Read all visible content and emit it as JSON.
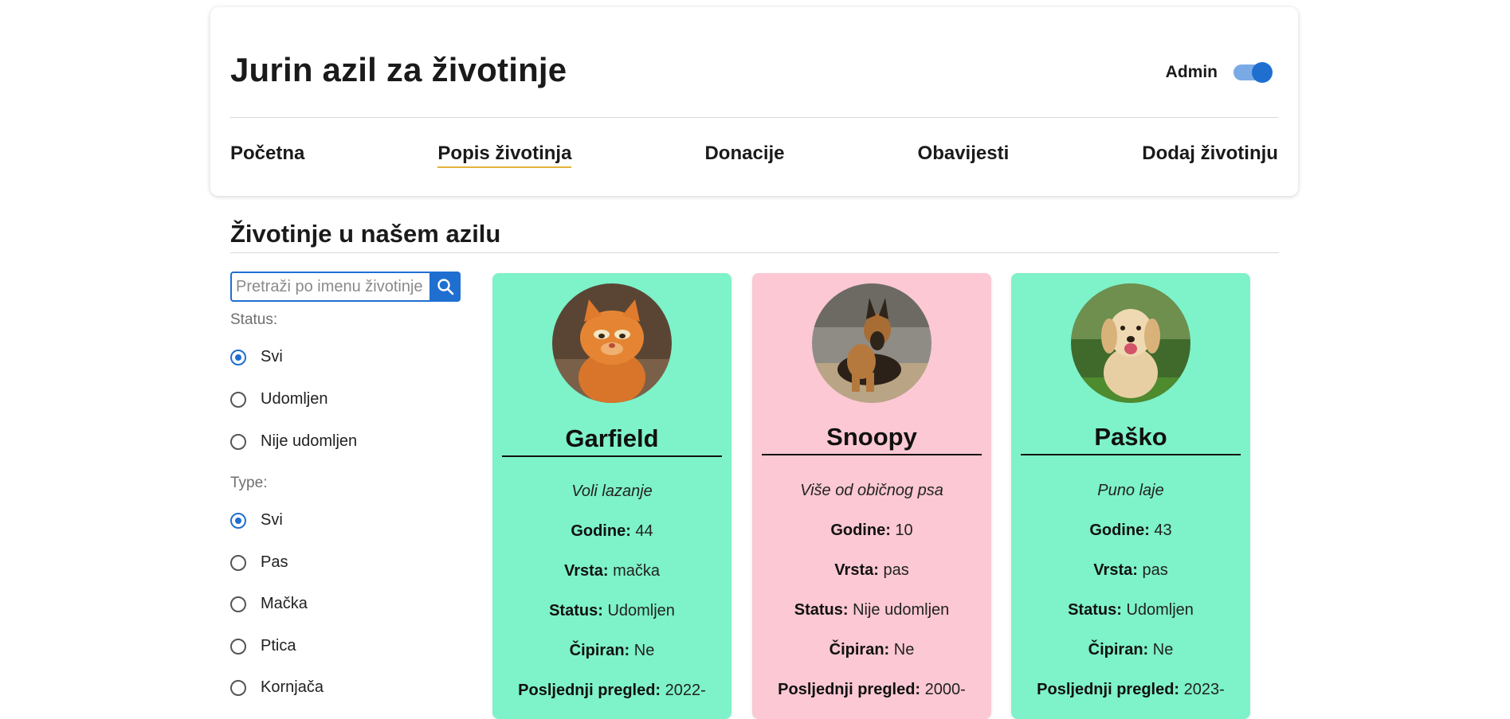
{
  "header": {
    "title": "Jurin azil za životinje",
    "admin_label": "Admin",
    "admin_toggle_on": true
  },
  "nav": [
    {
      "label": "Početna",
      "active": false
    },
    {
      "label": "Popis životinja",
      "active": true
    },
    {
      "label": "Donacije",
      "active": false
    },
    {
      "label": "Obavijesti",
      "active": false
    },
    {
      "label": "Dodaj životinju",
      "active": false
    }
  ],
  "main": {
    "title": "Životinje u našem azilu"
  },
  "search": {
    "placeholder": "Pretraži po imenu životinje",
    "value": ""
  },
  "filters": {
    "status": {
      "label": "Status:",
      "options": [
        {
          "label": "Svi",
          "checked": true
        },
        {
          "label": "Udomljen",
          "checked": false
        },
        {
          "label": "Nije udomljen",
          "checked": false
        }
      ]
    },
    "type": {
      "label": "Type:",
      "options": [
        {
          "label": "Svi",
          "checked": true
        },
        {
          "label": "Pas",
          "checked": false
        },
        {
          "label": "Mačka",
          "checked": false
        },
        {
          "label": "Ptica",
          "checked": false
        },
        {
          "label": "Kornjača",
          "checked": false
        }
      ]
    }
  },
  "field_labels": {
    "age": "Godine:",
    "species": "Vrsta:",
    "status": "Status:",
    "chipped": "Čipiran:",
    "last_checkup": "Posljednji pregled:"
  },
  "cards": [
    {
      "name": "Garfield",
      "description": "Voli lazanje",
      "age": "44",
      "species": "mačka",
      "status": "Udomljen",
      "chipped": "Ne",
      "last_checkup": "2022-",
      "background": "#7ef2c9",
      "photo": "orange-cat-photo"
    },
    {
      "name": "Snoopy",
      "description": "Više od običnog psa",
      "age": "10",
      "species": "pas",
      "status": "Nije udomljen",
      "chipped": "Ne",
      "last_checkup": "2000-",
      "background": "#fbc8d3",
      "photo": "german-shepherd-photo"
    },
    {
      "name": "Paško",
      "description": "Puno laje",
      "age": "43",
      "species": "pas",
      "status": "Udomljen",
      "chipped": "Ne",
      "last_checkup": "2023-",
      "background": "#7ef2c9",
      "photo": "golden-retriever-photo"
    }
  ],
  "colors": {
    "accent": "#1f6fd1",
    "nav_active_underline": "#e4b23a",
    "adopted_card": "#7ef2c9",
    "not_adopted_card": "#fbc8d3"
  }
}
